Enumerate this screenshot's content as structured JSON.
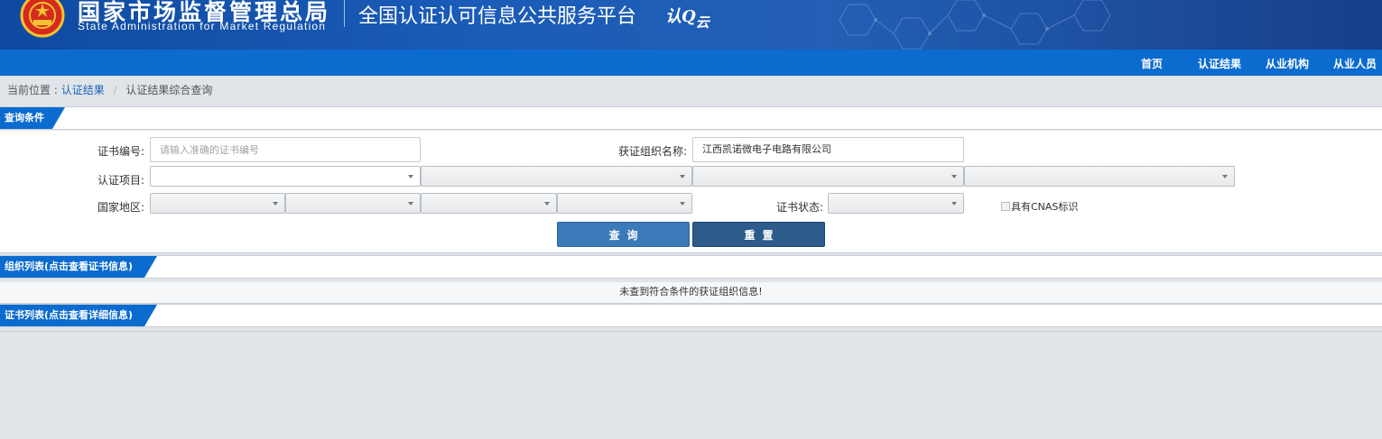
{
  "header": {
    "org_cn": "国家市场监督管理总局",
    "org_en": "State Administration  for  Market Regulation",
    "platform_title": "全国认证认可信息公共服务平台",
    "platform_logo_a": "认",
    "platform_logo_b": "Q",
    "platform_logo_c": "云"
  },
  "nav": {
    "items": [
      "首页",
      "认证结果",
      "从业机构",
      "从业人员"
    ]
  },
  "breadcrumb": {
    "prefix": "当前位置 :",
    "link": "认证结果",
    "separator": "/",
    "current": "认证结果综合查询"
  },
  "query": {
    "section_title": "查询条件",
    "cert_no_label": "证书编号:",
    "cert_no_placeholder": "请输入准确的证书编号",
    "cert_no_value": "",
    "org_name_label": "获证组织名称:",
    "org_name_value": "江西凯诺微电子电路有限公司",
    "project_label": "认证项目:",
    "region_label": "国家地区:",
    "status_label": "证书状态:",
    "cnas_label": "具有CNAS标识",
    "query_button": "查询",
    "reset_button": "重置"
  },
  "org_list": {
    "section_title": "组织列表(点击查看证书信息)",
    "empty_message": "未查到符合条件的获证组织信息!"
  },
  "cert_list": {
    "section_title": "证书列表(点击查看详细信息)"
  },
  "colors": {
    "banner": "#1a5cb8",
    "nav": "#0c6bcf",
    "query_button": "#3c79b8",
    "reset_button": "#2c5b8c"
  }
}
